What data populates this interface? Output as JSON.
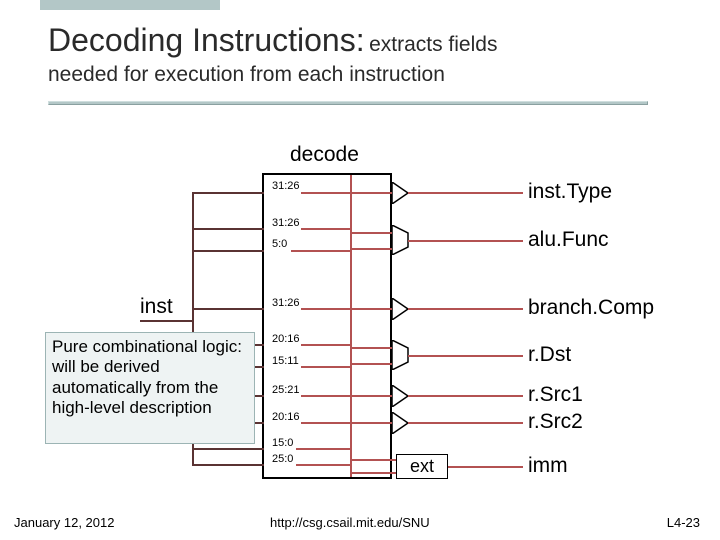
{
  "title": {
    "main": "Decoding Instructions:",
    "sub": "extracts fields",
    "subtitle": "needed for execution from each instruction"
  },
  "decode_label": "decode",
  "inst_label": "inst",
  "bit_ranges": {
    "instType_a": "31:26",
    "aluFunc_a": "31:26",
    "aluFunc_b": "5:0",
    "branchComp_a": "31:26",
    "rDst_a": "20:16",
    "rDst_b": "15:11",
    "rSrc1_a": "25:21",
    "rSrc2_a": "20:16",
    "imm_a": "15:0",
    "imm_b": "25:0"
  },
  "outputs": {
    "instType": "inst.Type",
    "aluFunc": "alu.Func",
    "branchComp": "branch.Comp",
    "rDst": "r.Dst",
    "rSrc1": "r.Src1",
    "rSrc2": "r.Src2",
    "imm": "imm"
  },
  "ext_label": "ext",
  "note": "Pure combinational logic: will be derived automatically from the high-level description",
  "footer": {
    "date": "January 12, 2012",
    "url": "http://csg.csail.mit.edu/SNU",
    "page": "L4-23"
  }
}
